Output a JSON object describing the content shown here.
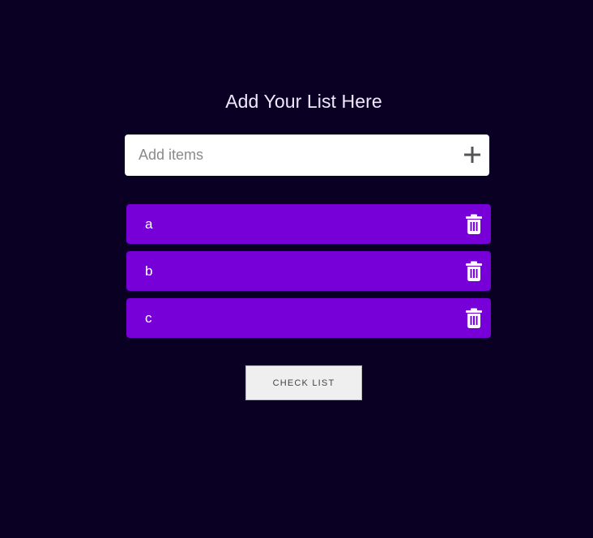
{
  "heading": "Add Your List Here",
  "input": {
    "placeholder": "Add items",
    "value": ""
  },
  "add_icon": "plus-icon",
  "items": [
    {
      "label": "a",
      "icon": "trash-icon"
    },
    {
      "label": "b",
      "icon": "trash-icon"
    },
    {
      "label": "c",
      "icon": "trash-icon"
    }
  ],
  "check_button_label": "CHECK LIST",
  "colors": {
    "background": "#0a0023",
    "item": "#7700d9",
    "heading": "#f1e8ff",
    "button": "#efefef"
  }
}
